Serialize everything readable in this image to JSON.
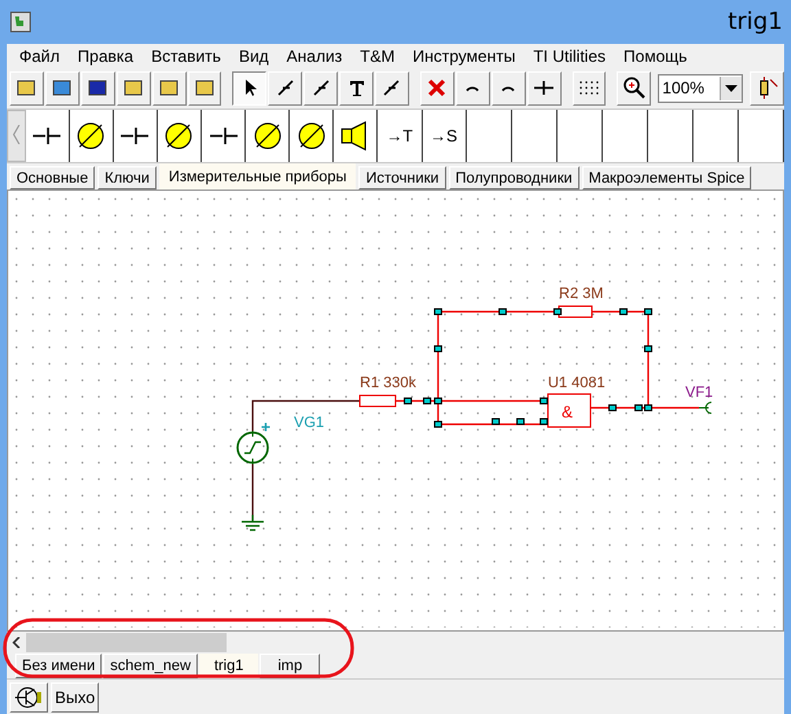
{
  "window": {
    "title": "trig1"
  },
  "menu": [
    "Файл",
    "Правка",
    "Вставить",
    "Вид",
    "Анализ",
    "T&M",
    "Инструменты",
    "TI Utilities",
    "Помощь"
  ],
  "toolbar": {
    "zoom": "100%"
  },
  "component_toolbar": {
    "texts": [
      "→T",
      "→S"
    ]
  },
  "category_tabs": [
    {
      "label": "Основные",
      "selected": false
    },
    {
      "label": "Ключи",
      "selected": false
    },
    {
      "label": "Измерительные приборы",
      "selected": true
    },
    {
      "label": "Источники",
      "selected": false
    },
    {
      "label": "Полупроводники",
      "selected": false
    },
    {
      "label": "Макроэлементы Spice",
      "selected": false
    }
  ],
  "schematic": {
    "labels": [
      {
        "text": "R1 330k",
        "kind": "part"
      },
      {
        "text": "VG1",
        "kind": "source"
      },
      {
        "text": "R2 3M",
        "kind": "part"
      },
      {
        "text": "U1 4081",
        "kind": "part"
      },
      {
        "text": "VF1",
        "kind": "probe"
      }
    ],
    "gate_symbol": "&",
    "plus": "+"
  },
  "document_tabs": [
    {
      "label": "Без имени",
      "selected": false
    },
    {
      "label": "schem_new",
      "selected": false
    },
    {
      "label": "trig1",
      "selected": true
    },
    {
      "label": "imp",
      "selected": false
    }
  ],
  "status_bar": {
    "button": "Выхо"
  }
}
